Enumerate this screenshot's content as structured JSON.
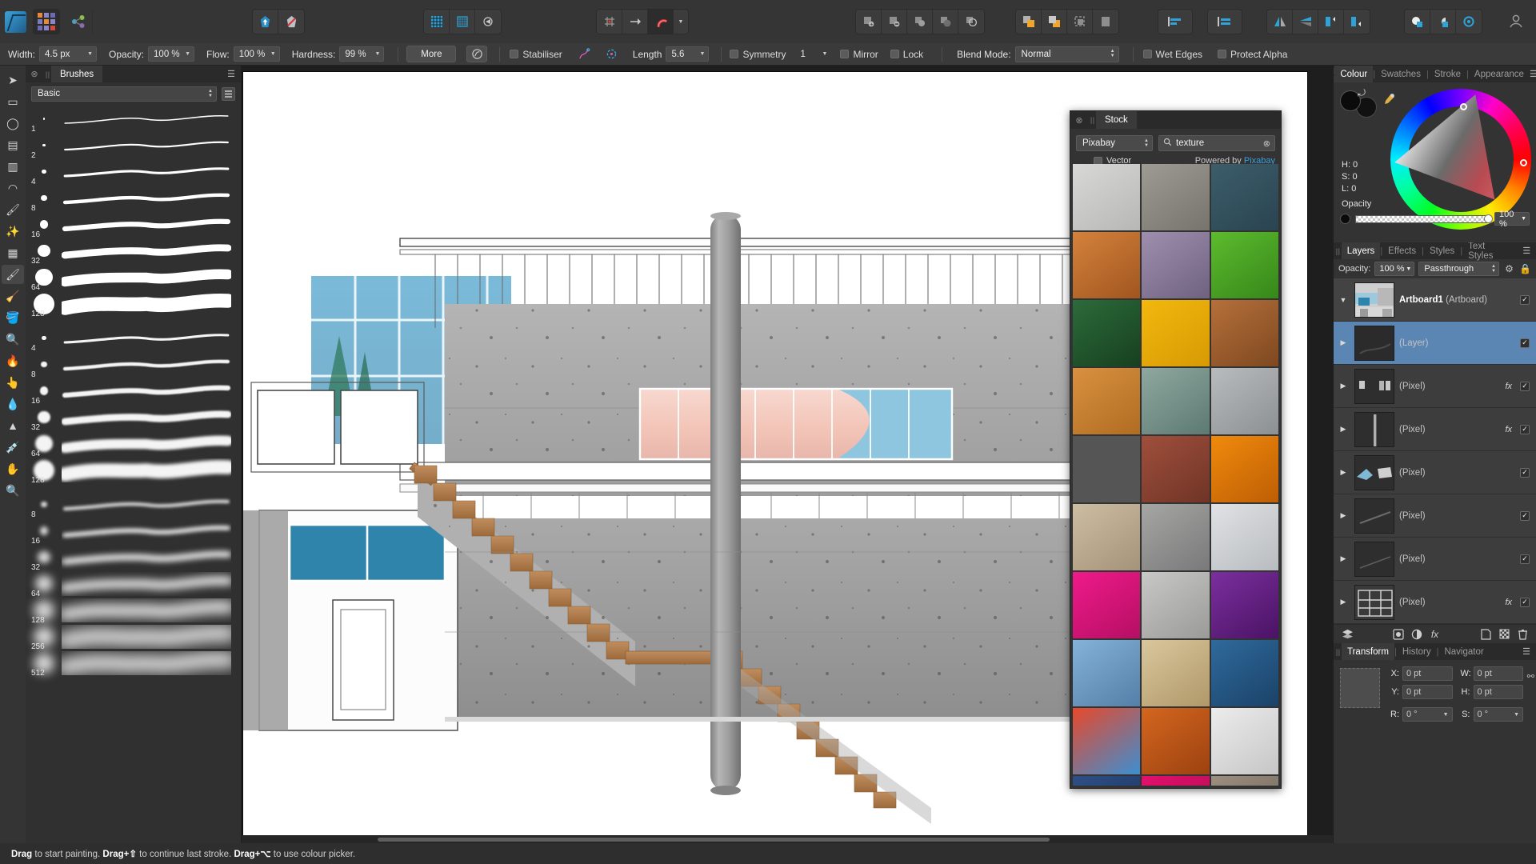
{
  "app": {
    "name": "Affinity Photo",
    "logo_icon": "affinity-photo-logo"
  },
  "toolbar": {
    "left_icons": [
      "app-logo-icon",
      "persona-grid-icon",
      "share-icon"
    ],
    "doc_icons": [
      "export-persona-icon",
      "no-edit-icon"
    ],
    "snap_icons": [
      "show-grid-icon",
      "move-to-icon",
      "snapping-magnet-icon",
      "snapping-dropdown-icon"
    ],
    "geometry_icons": [
      "add-icon",
      "subtract-icon",
      "intersect-icon",
      "divide-icon",
      "combine-icon"
    ],
    "arrange_icons": [
      "move-front-icon",
      "move-back-icon",
      "group-icon",
      "ungroup-icon"
    ],
    "align_icons": [
      "align-left-icon",
      "distribute-icon"
    ],
    "flip_icons": [
      "flip-horizontal-icon",
      "flip-vertical-icon",
      "rotate-left-icon",
      "rotate-right-icon"
    ],
    "mask_icons": [
      "mask-add-icon",
      "mask-subtract-icon",
      "mask-intersect-icon"
    ],
    "account_icon": "user-account-icon"
  },
  "context_bar": {
    "width_label": "Width:",
    "width_value": "4.5 px",
    "opacity_label": "Opacity:",
    "opacity_value": "100 %",
    "flow_label": "Flow:",
    "flow_value": "100 %",
    "hardness_label": "Hardness:",
    "hardness_value": "99 %",
    "more_label": "More",
    "brush_settings_icon": "brush-settings-icon",
    "stabiliser_label": "Stabiliser",
    "rope_icon": "rope-mode-icon",
    "window_icon": "window-mode-icon",
    "length_label": "Length",
    "length_value": "5.6",
    "symmetry_label": "Symmetry",
    "symmetry_value": "1",
    "mirror_label": "Mirror",
    "lock_label": "Lock",
    "blend_mode_label": "Blend Mode:",
    "blend_mode_value": "Normal",
    "wet_edges_label": "Wet Edges",
    "protect_alpha_label": "Protect Alpha"
  },
  "tools": [
    {
      "name": "move-tool",
      "icon": "cursor-arrow-icon"
    },
    {
      "name": "rectangular-marquee-tool",
      "icon": "rect-marquee-icon"
    },
    {
      "name": "elliptical-marquee-tool",
      "icon": "ellipse-marquee-icon"
    },
    {
      "name": "row-marquee-tool",
      "icon": "row-marquee-icon"
    },
    {
      "name": "column-marquee-tool",
      "icon": "column-marquee-icon"
    },
    {
      "name": "freehand-selection-tool",
      "icon": "lasso-icon"
    },
    {
      "name": "selection-brush-tool",
      "icon": "selection-brush-icon"
    },
    {
      "name": "flood-select-tool",
      "icon": "magic-wand-icon"
    },
    {
      "name": "pixel-tool",
      "icon": "pixel-grid-icon"
    },
    {
      "name": "paint-brush-tool",
      "icon": "paint-brush-icon",
      "selected": true
    },
    {
      "name": "erase-brush-tool",
      "icon": "eraser-icon"
    },
    {
      "name": "flood-fill-tool",
      "icon": "paint-bucket-icon"
    },
    {
      "name": "dodge-brush-tool",
      "icon": "dodge-icon"
    },
    {
      "name": "burn-brush-tool",
      "icon": "burn-flame-icon"
    },
    {
      "name": "smudge-brush-tool",
      "icon": "smudge-icon"
    },
    {
      "name": "blur-brush-tool",
      "icon": "blur-drop-icon"
    },
    {
      "name": "sharpen-brush-tool",
      "icon": "sharpen-cone-icon"
    },
    {
      "name": "colour-picker-tool",
      "icon": "eyedropper-icon"
    },
    {
      "name": "view-pan-tool",
      "icon": "hand-icon"
    },
    {
      "name": "zoom-tool",
      "icon": "magnifier-icon"
    }
  ],
  "brushes_panel": {
    "close_icon": "close-icon",
    "tab_label": "Brushes",
    "menu_icon": "panel-menu-icon",
    "category_value": "Basic",
    "list_view_icon": "list-view-icon",
    "groups": [
      {
        "style": "hard",
        "sizes": [
          "1",
          "2",
          "4",
          "8",
          "16",
          "32",
          "64",
          "128"
        ]
      },
      {
        "style": "medium",
        "sizes": [
          "4",
          "8",
          "16",
          "32",
          "64",
          "128"
        ]
      },
      {
        "style": "soft",
        "sizes": [
          "8",
          "16",
          "32",
          "64",
          "128",
          "256",
          "512"
        ]
      }
    ]
  },
  "stock_panel": {
    "close_icon": "close-icon",
    "grip_icon": "drag-grip-icon",
    "tab_label": "Stock",
    "source_value": "Pixabay",
    "search_icon": "search-icon",
    "search_value": "texture",
    "clear_icon": "clear-search-icon",
    "vector_label": "Vector",
    "powered_prefix": "Powered by",
    "powered_link": "Pixabay",
    "thumbnails": [
      {
        "name": "concrete-light",
        "c1": "#d8d8d6",
        "c2": "#b7b7b4"
      },
      {
        "name": "stone-wall",
        "c1": "#9d9b93",
        "c2": "#76746c"
      },
      {
        "name": "dark-teal-slate",
        "c1": "#3c5d6b",
        "c2": "#2a4450"
      },
      {
        "name": "wood-rings",
        "c1": "#d4823c",
        "c2": "#a1561f"
      },
      {
        "name": "mosaic-tiles",
        "c1": "#9f8fae",
        "c2": "#6e6280"
      },
      {
        "name": "green-grass",
        "c1": "#5dbb2e",
        "c2": "#36871a"
      },
      {
        "name": "green-leaf",
        "c1": "#2c6b3a",
        "c2": "#17401f"
      },
      {
        "name": "yellow-paint",
        "c1": "#f2b80d",
        "c2": "#d79a04"
      },
      {
        "name": "wood-planks",
        "c1": "#b5703a",
        "c2": "#7e4820"
      },
      {
        "name": "orange-wood",
        "c1": "#d9913f",
        "c2": "#b06c22"
      },
      {
        "name": "teal-rust",
        "c1": "#8fa89f",
        "c2": "#5c7a72"
      },
      {
        "name": "blue-grey-stone",
        "c1": "#b9bcbd",
        "c2": "#8b9092"
      },
      {
        "name": "tree-stump",
        "c1": "#b07a44",
        "c2": "#734река"
      },
      {
        "name": "red-brick",
        "c1": "#a04f3c",
        "c2": "#6f3426"
      },
      {
        "name": "autumn-leaves",
        "c1": "#f08a0d",
        "c2": "#bd5e04"
      },
      {
        "name": "beige-plaster",
        "c1": "#cdbda1",
        "c2": "#a4937a"
      },
      {
        "name": "grey-concrete",
        "c1": "#a6a6a4",
        "c2": "#79797a"
      },
      {
        "name": "white-marble",
        "c1": "#e0e2e4",
        "c2": "#b8bcc0"
      },
      {
        "name": "pink-flowers",
        "c1": "#ef1a8a",
        "c2": "#b50f63"
      },
      {
        "name": "crumpled-paper",
        "c1": "#c8c8c6",
        "c2": "#9a9a98"
      },
      {
        "name": "purple-smoke",
        "c1": "#7b2f9e",
        "c2": "#4a1364"
      },
      {
        "name": "blue-sky-clouds",
        "c1": "#84b2d8",
        "c2": "#547fa8"
      },
      {
        "name": "sand-dune",
        "c1": "#d9c79b",
        "c2": "#b0986a"
      },
      {
        "name": "blue-rust",
        "c1": "#2f6a9c",
        "c2": "#1a4268"
      },
      {
        "name": "rainbow-fabric",
        "c1": "#e8482a",
        "c2": "#3c8fd1"
      },
      {
        "name": "orange-canyon",
        "c1": "#d4661f",
        "c2": "#9c4210"
      },
      {
        "name": "white-brick",
        "c1": "#ececec",
        "c2": "#c6c6c6"
      },
      {
        "name": "blue-denim",
        "c1": "#2e4f87",
        "c2": "#1a3159"
      },
      {
        "name": "magenta-paint",
        "c1": "#e3106d",
        "c2": "#a80a4e"
      },
      {
        "name": "grey-brick-wall",
        "c1": "#9b8f80",
        "c2": "#6d6256"
      }
    ]
  },
  "colour_panel": {
    "tabs": [
      "Colour",
      "Swatches",
      "Stroke",
      "Appearance"
    ],
    "active_tab": "Colour",
    "menu_icon": "panel-menu-icon",
    "swap_icon": "swap-colours-icon",
    "picker_icon": "eyedropper-icon",
    "h_label": "H: 0",
    "s_label": "S: 0",
    "l_label": "L: 0",
    "opacity_label": "Opacity",
    "opacity_value": "100 %",
    "wheel_icon": "colour-wheel-icon"
  },
  "layers_panel": {
    "tabs": [
      "Layers",
      "Effects",
      "Styles",
      "Text Styles"
    ],
    "active_tab": "Layers",
    "menu_icon": "panel-menu-icon",
    "opacity_label": "Opacity:",
    "opacity_value": "100 %",
    "blend_value": "Passthrough",
    "settings_icon": "gear-icon",
    "lock_icon": "lock-icon",
    "rows": [
      {
        "name": "Artboard1",
        "suffix": "(Artboard)",
        "bold": true,
        "selected": false,
        "has_fx": false,
        "checked": true,
        "arrow": "down",
        "thumb": "artboard-thumb"
      },
      {
        "name": "",
        "suffix": "(Layer)",
        "bold": false,
        "selected": true,
        "has_fx": false,
        "checked": true,
        "arrow": "right",
        "thumb": "layer-thumb"
      },
      {
        "name": "",
        "suffix": "(Pixel)",
        "bold": false,
        "selected": false,
        "has_fx": true,
        "checked": true,
        "arrow": "right",
        "thumb": "pixel-thumb-1"
      },
      {
        "name": "",
        "suffix": "(Pixel)",
        "bold": false,
        "selected": false,
        "has_fx": true,
        "checked": true,
        "arrow": "right",
        "thumb": "pixel-thumb-2"
      },
      {
        "name": "",
        "suffix": "(Pixel)",
        "bold": false,
        "selected": false,
        "has_fx": false,
        "checked": true,
        "arrow": "right",
        "thumb": "pixel-thumb-3"
      },
      {
        "name": "",
        "suffix": "(Pixel)",
        "bold": false,
        "selected": false,
        "has_fx": false,
        "checked": true,
        "arrow": "right",
        "thumb": "pixel-thumb-4"
      },
      {
        "name": "",
        "suffix": "(Pixel)",
        "bold": false,
        "selected": false,
        "has_fx": false,
        "checked": true,
        "arrow": "right",
        "thumb": "pixel-thumb-5"
      },
      {
        "name": "",
        "suffix": "(Pixel)",
        "bold": false,
        "selected": false,
        "has_fx": true,
        "checked": true,
        "arrow": "right",
        "thumb": "pixel-thumb-6"
      }
    ],
    "footer_icons": [
      "layer-stack-icon",
      "adjustment-icon",
      "live-filter-icon",
      "fx-icon",
      "add-layer-icon",
      "mask-icon",
      "delete-icon"
    ]
  },
  "transform_panel": {
    "tabs": [
      "Transform",
      "History",
      "Navigator"
    ],
    "active_tab": "Transform",
    "x_label": "X:",
    "x_value": "0 pt",
    "y_label": "Y:",
    "y_value": "0 pt",
    "w_label": "W:",
    "w_value": "0 pt",
    "h_label": "H:",
    "h_value": "0 pt",
    "r_label": "R:",
    "r_value": "0 °",
    "s_label": "S:",
    "s_value": "0 °",
    "link_icon": "link-ratio-icon",
    "anchor_icon": "transform-anchor-icon"
  },
  "status_bar": {
    "segments": [
      {
        "bold": "Drag",
        "text": " to start painting. "
      },
      {
        "bold": "Drag+⇧",
        "text": " to continue last stroke. "
      },
      {
        "bold": "Drag+⌥",
        "text": " to use colour picker."
      }
    ],
    "full_text": "Drag to start painting. Drag+⇧ to continue last stroke. Drag+⌥ to use colour picker."
  },
  "canvas": {
    "title": "architectural-building-render",
    "description": "Modern concrete building elevation with glass facade, external staircase and a central round column"
  }
}
